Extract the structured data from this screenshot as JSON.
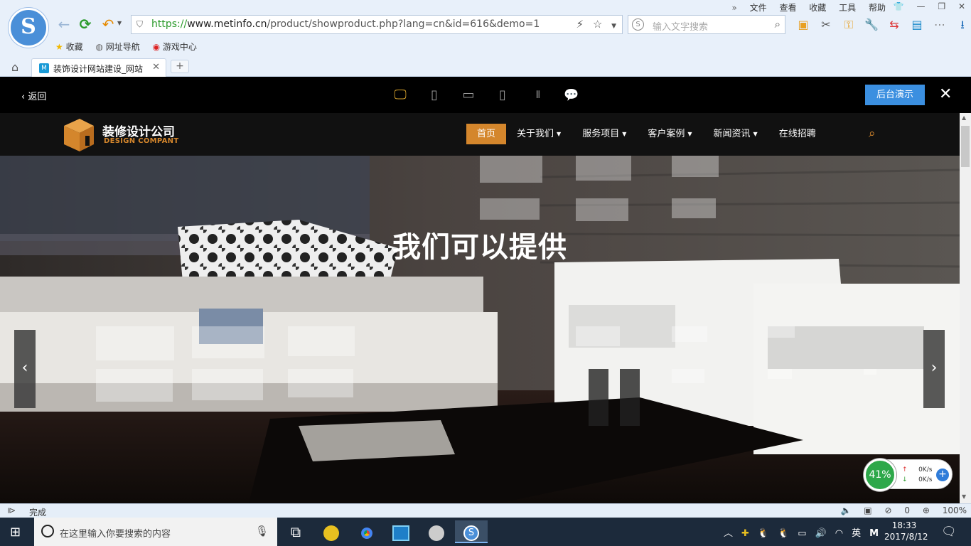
{
  "browser": {
    "back_icon": "back-arrow-icon",
    "refresh_icon": "refresh-icon",
    "undo_icon": "undo-icon",
    "address": {
      "scheme": "https://",
      "host": "www.metinfo.cn",
      "path": "/product/showproduct.php?lang=cn&id=616&demo=1"
    },
    "search_placeholder": "输入文字搜索",
    "menus": [
      "文件",
      "查看",
      "收藏",
      "工具",
      "帮助"
    ],
    "favorites": [
      {
        "label": "收藏",
        "icon": "star-icon"
      },
      {
        "label": "网址导航",
        "icon": "globe-icon"
      },
      {
        "label": "游戏中心",
        "icon": "game-icon"
      }
    ],
    "tab_title": "装饰设计网站建设_网站",
    "new_tab": "+",
    "accent": "#3b8fe0"
  },
  "demo_bar": {
    "back_label": "返回",
    "admin_button": "后台演示",
    "accent": "#d4a12c"
  },
  "site": {
    "brand_cn": "装修设计公司",
    "brand_en": "DESIGN COMPANT",
    "nav": {
      "home": "首页",
      "about": "关于我们",
      "services": "服务项目",
      "cases": "客户案例",
      "news": "新闻资讯",
      "jobs": "在线招聘"
    },
    "accent": "#d4862c",
    "hero_title": "我们可以提供"
  },
  "widget": {
    "percent": "41%",
    "up": "0K/s",
    "down": "0K/s"
  },
  "statusbar": {
    "status": "完成",
    "count": "0",
    "zoom": "100%"
  },
  "taskbar": {
    "search_placeholder": "在这里输入你要搜索的内容",
    "ime": "英",
    "time": "18:33",
    "date": "2017/8/12"
  }
}
